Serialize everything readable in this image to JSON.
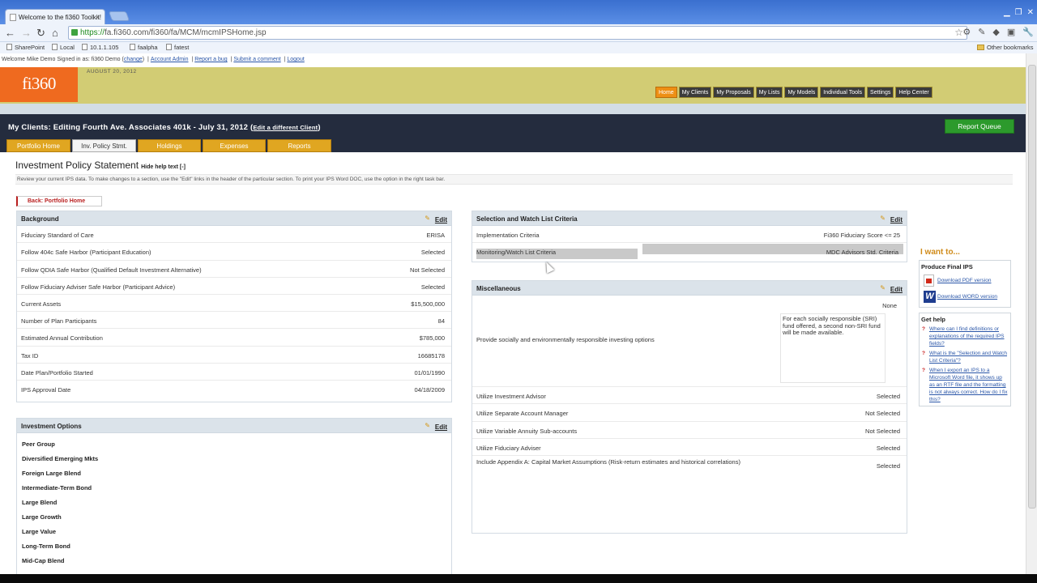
{
  "browser": {
    "tab_title": "Welcome to the fi360 Toolkit!",
    "tab_close": "×",
    "url_scheme": "https://",
    "url_rest": "fa.fi360.com/fi360/fa/MCM/mcmIPSHome.jsp",
    "bookmarks": [
      "SharePoint",
      "Local",
      "10.1.1.105",
      "faalpha",
      "fatest"
    ],
    "other_bookmarks": "Other bookmarks"
  },
  "welcome": {
    "text": "Welcome Mike Demo  Signed in as: fi360 Demo (",
    "change": "change",
    "close": ")",
    "links": [
      "Account Admin",
      "Report a bug",
      "Submit a comment",
      "Logout"
    ],
    "sep": "|"
  },
  "banner": {
    "logo": "fi360",
    "date": "AUGUST 20, 2012",
    "nav": [
      "Home",
      "My Clients",
      "My Proposals",
      "My Lists",
      "My Models",
      "Individual Tools",
      "Settings",
      "Help Center"
    ]
  },
  "client": {
    "title": "My Clients: Editing Fourth Ave. Associates 401k - July 31, 2012 (",
    "change_link": "Edit a different Client",
    "close": ")",
    "report_queue": "Report Queue",
    "tabs": [
      "Portfolio Home",
      "Inv. Policy Stmt.",
      "Holdings",
      "Expenses",
      "Reports"
    ]
  },
  "ips": {
    "title": "Investment Policy Statement",
    "hide_help": "Hide help text [-]",
    "help_text": "Review your current IPS data. To make changes to a section, use the \"Edit\" links in the header of the particular section. To print your IPS Word DOC, use the option in the right task bar.",
    "back": "Back: Portfolio Home",
    "edit": "Edit"
  },
  "background": {
    "title": "Background",
    "rows": [
      {
        "label": "Fiduciary Standard of Care",
        "value": "ERISA"
      },
      {
        "label": "Follow 404c Safe Harbor (Participant Education)",
        "value": "Selected"
      },
      {
        "label": "Follow QDIA Safe Harbor (Qualified Default Investment Alternative)",
        "value": "Not Selected"
      },
      {
        "label": "Follow Fiduciary Adviser Safe Harbor (Participant Advice)",
        "value": "Selected"
      },
      {
        "label": "Current Assets",
        "value": "$15,500,000"
      },
      {
        "label": "Number of Plan Participants",
        "value": "84"
      },
      {
        "label": "Estimated Annual Contribution",
        "value": "$785,000"
      },
      {
        "label": "Tax ID",
        "value": "16685178"
      },
      {
        "label": "Date Plan/Portfolio Started",
        "value": "01/01/1990"
      },
      {
        "label": "IPS Approval Date",
        "value": "04/18/2009"
      }
    ]
  },
  "investment_options": {
    "title": "Investment Options",
    "items": [
      "Peer Group",
      "Diversified Emerging Mkts",
      "Foreign Large Blend",
      "Intermediate-Term Bond",
      "Large Blend",
      "Large Growth",
      "Large Value",
      "Long-Term Bond",
      "Mid-Cap Blend"
    ]
  },
  "selection": {
    "title": "Selection and Watch List Criteria",
    "rows": [
      {
        "label": "Implementation Criteria",
        "value": "Fi360 Fiduciary Score <= 25"
      },
      {
        "label": "Monitoring/Watch List Criteria",
        "value": "MDC Advisors Std. Criteria"
      }
    ]
  },
  "misc": {
    "title": "Miscellaneous",
    "sri_label": "Provide socially and environmentally responsible investing options",
    "sri_value": "None",
    "sri_note": "For each socially responsible (SRI) fund offered, a second non-SRI fund will be made available.",
    "rows": [
      {
        "label": "Utilize Investment Advisor",
        "value": "Selected"
      },
      {
        "label": "Utilize Separate Account Manager",
        "value": "Not Selected"
      },
      {
        "label": "Utilize Variable Annuity Sub-accounts",
        "value": "Not Selected"
      },
      {
        "label": "Utilize Fiduciary Adviser",
        "value": "Selected"
      },
      {
        "label": "Include Appendix A: Capital Market Assumptions (Risk-return estimates and historical correlations)",
        "value": "Selected"
      }
    ]
  },
  "sidebar": {
    "heading": "I want to...",
    "produce_title": "Produce Final IPS",
    "pdf": "Download PDF version",
    "word": "Download WORD version",
    "help_title": "Get help",
    "help_links": [
      "Where can I find definitions or explanations of the required IPS fields?",
      "What is the \"Selection and Watch List Criteria\"?",
      "When I export an IPS to a Microsoft Word file, it shows up as an RTF file and the formatting is not always correct. How do I fix this?"
    ]
  }
}
